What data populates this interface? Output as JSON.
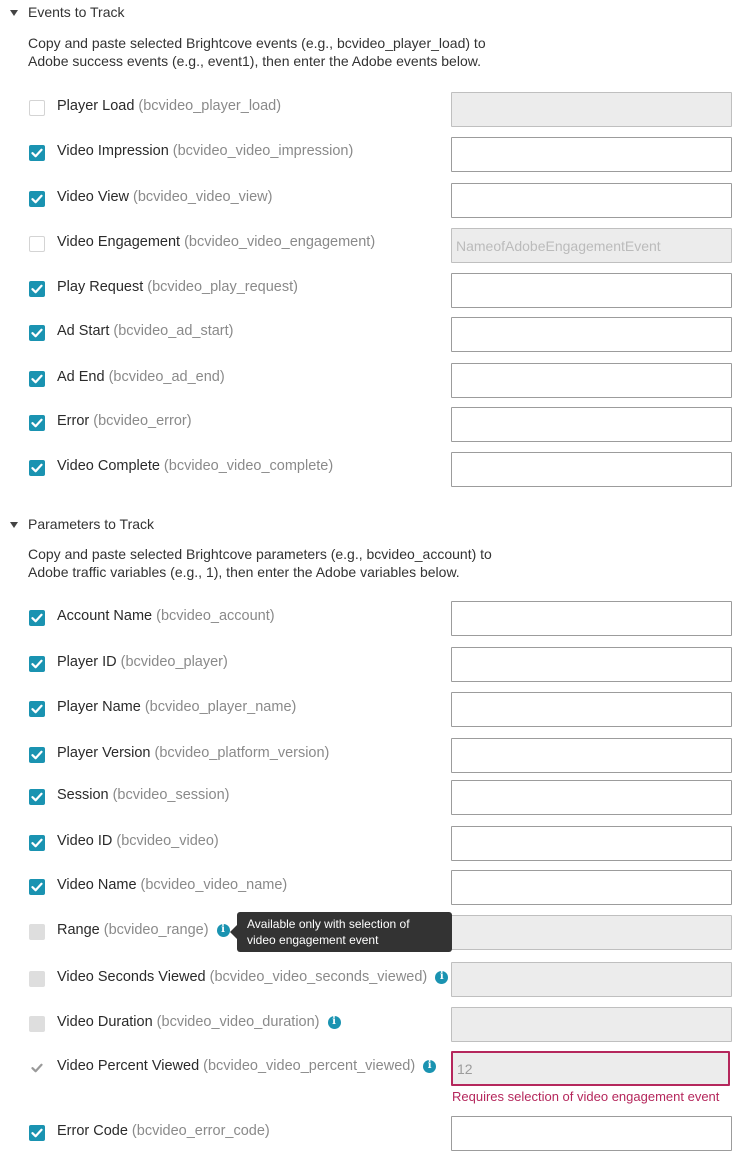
{
  "events_section": {
    "title": "Events to Track",
    "desc_line1": "Copy and paste selected Brightcove events (e.g., bcvideo_player_load) to",
    "desc_line2": "Adobe success events (e.g., event1), then enter the Adobe events below.",
    "items": [
      {
        "label": "Player Load",
        "key": "(bcvideo_player_load)",
        "checked": false,
        "state": "off",
        "field_value": "",
        "field_placeholder": "",
        "field_state": "disabled"
      },
      {
        "label": "Video Impression",
        "key": "(bcvideo_video_impression)",
        "checked": true,
        "state": "on",
        "field_value": "",
        "field_placeholder": "",
        "field_state": "normal"
      },
      {
        "label": "Video View",
        "key": "(bcvideo_video_view)",
        "checked": true,
        "state": "on",
        "field_value": "",
        "field_placeholder": "",
        "field_state": "normal"
      },
      {
        "label": "Video Engagement ",
        "key": "(bcvideo_video_engagement)",
        "checked": false,
        "state": "off",
        "field_value": "",
        "field_placeholder": "NameofAdobeEngagementEvent",
        "field_state": "disabled"
      },
      {
        "label": "Play Request",
        "key": "(bcvideo_play_request)",
        "checked": true,
        "state": "on",
        "field_value": "",
        "field_placeholder": "",
        "field_state": "normal"
      },
      {
        "label": "Ad Start",
        "key": "(bcvideo_ad_start)",
        "checked": true,
        "state": "on",
        "field_value": "",
        "field_placeholder": "",
        "field_state": "normal"
      },
      {
        "label": "Ad End",
        "key": "(bcvideo_ad_end)",
        "checked": true,
        "state": "on",
        "field_value": "",
        "field_placeholder": "",
        "field_state": "normal"
      },
      {
        "label": "Error",
        "key": "(bcvideo_error)",
        "checked": true,
        "state": "on",
        "field_value": "",
        "field_placeholder": "",
        "field_state": "normal"
      },
      {
        "label": "Video Complete",
        "key": "(bcvideo_video_complete)",
        "checked": true,
        "state": "on",
        "field_value": "",
        "field_placeholder": "",
        "field_state": "normal"
      }
    ]
  },
  "params_section": {
    "title": "Parameters to Track",
    "desc_line1": "Copy and paste selected Brightcove parameters (e.g., bcvideo_account) to",
    "desc_line2": "Adobe traffic variables (e.g., 1), then enter the Adobe variables below.",
    "items": [
      {
        "label": "Account Name",
        "key": "(bcvideo_account)",
        "state": "on",
        "info": false,
        "field_value": "",
        "field_state": "normal"
      },
      {
        "label": "Player ID",
        "key": "(bcvideo_player)",
        "state": "on",
        "info": false,
        "field_value": "",
        "field_state": "normal"
      },
      {
        "label": "Player Name",
        "key": "(bcvideo_player_name)",
        "state": "on",
        "info": false,
        "field_value": "",
        "field_state": "normal"
      },
      {
        "label": "Player Version",
        "key": "(bcvideo_platform_version)",
        "state": "on",
        "info": false,
        "field_value": "",
        "field_state": "normal"
      },
      {
        "label": "Session",
        "key": "(bcvideo_session)",
        "state": "on",
        "info": false,
        "field_value": "",
        "field_state": "normal"
      },
      {
        "label": "Video ID",
        "key": "(bcvideo_video)",
        "state": "on",
        "info": false,
        "field_value": "",
        "field_state": "normal"
      },
      {
        "label": "Video Name",
        "key": "(bcvideo_video_name)",
        "state": "on",
        "info": false,
        "field_value": "",
        "field_state": "normal"
      },
      {
        "label": "Range",
        "key": "(bcvideo_range)",
        "state": "disabled",
        "info": true,
        "field_value": "",
        "field_state": "disabled"
      },
      {
        "label": "Video Seconds Viewed",
        "key": "(bcvideo_video_seconds_viewed)",
        "state": "disabled",
        "info": true,
        "field_value": "",
        "field_state": "disabled"
      },
      {
        "label": "Video Duration",
        "key": "(bcvideo_video_duration)",
        "state": "disabled",
        "info": true,
        "field_value": "",
        "field_state": "disabled"
      },
      {
        "label": "Video Percent Viewed",
        "key": "(bcvideo_video_percent_viewed)",
        "state": "disabled-checked",
        "info": true,
        "field_value": "12",
        "field_state": "error"
      },
      {
        "label": "Error Code",
        "key": "(bcvideo_error_code)",
        "state": "on",
        "info": false,
        "field_value": "",
        "field_state": "normal"
      }
    ]
  },
  "tooltip": {
    "line1": "Available only with selection of",
    "line2": "video engagement event"
  },
  "error_message": "Requires selection of video engagement event",
  "colors": {
    "accent": "#1a93b1",
    "error": "#b5275c",
    "tooltip_bg": "#333333"
  }
}
